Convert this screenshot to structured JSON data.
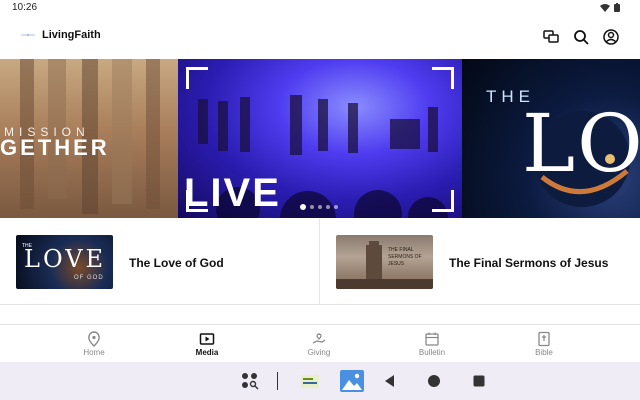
{
  "status_bar": {
    "time": "10:26"
  },
  "app": {
    "name": "LivingFaith"
  },
  "carousel": {
    "slides": [
      {
        "line1": "MISSION",
        "line2": "GETHER"
      },
      {
        "label": "LIVE"
      },
      {
        "line1": "THE",
        "line2": "LO"
      }
    ],
    "page_count": 5,
    "active_page": 1
  },
  "media": {
    "items": [
      {
        "title": "The Love of God",
        "thumb_title": "LOVE",
        "thumb_sub": "OF GOD",
        "thumb_top": "THE"
      },
      {
        "title": "The Final Sermons of Jesus",
        "thumb_text": "THE FINAL SERMONS OF JESUS"
      }
    ]
  },
  "nav": {
    "items": [
      {
        "label": "Home",
        "icon": "location-pin-icon",
        "active": false
      },
      {
        "label": "Media",
        "icon": "play-icon",
        "active": true
      },
      {
        "label": "Giving",
        "icon": "heart-hand-icon",
        "active": false
      },
      {
        "label": "Bulletin",
        "icon": "calendar-icon",
        "active": false
      },
      {
        "label": "Bible",
        "icon": "bible-icon",
        "active": false
      }
    ]
  },
  "colors": {
    "accent": "#111111",
    "inactive": "#888888",
    "system_bar": "#f0ecf6"
  }
}
